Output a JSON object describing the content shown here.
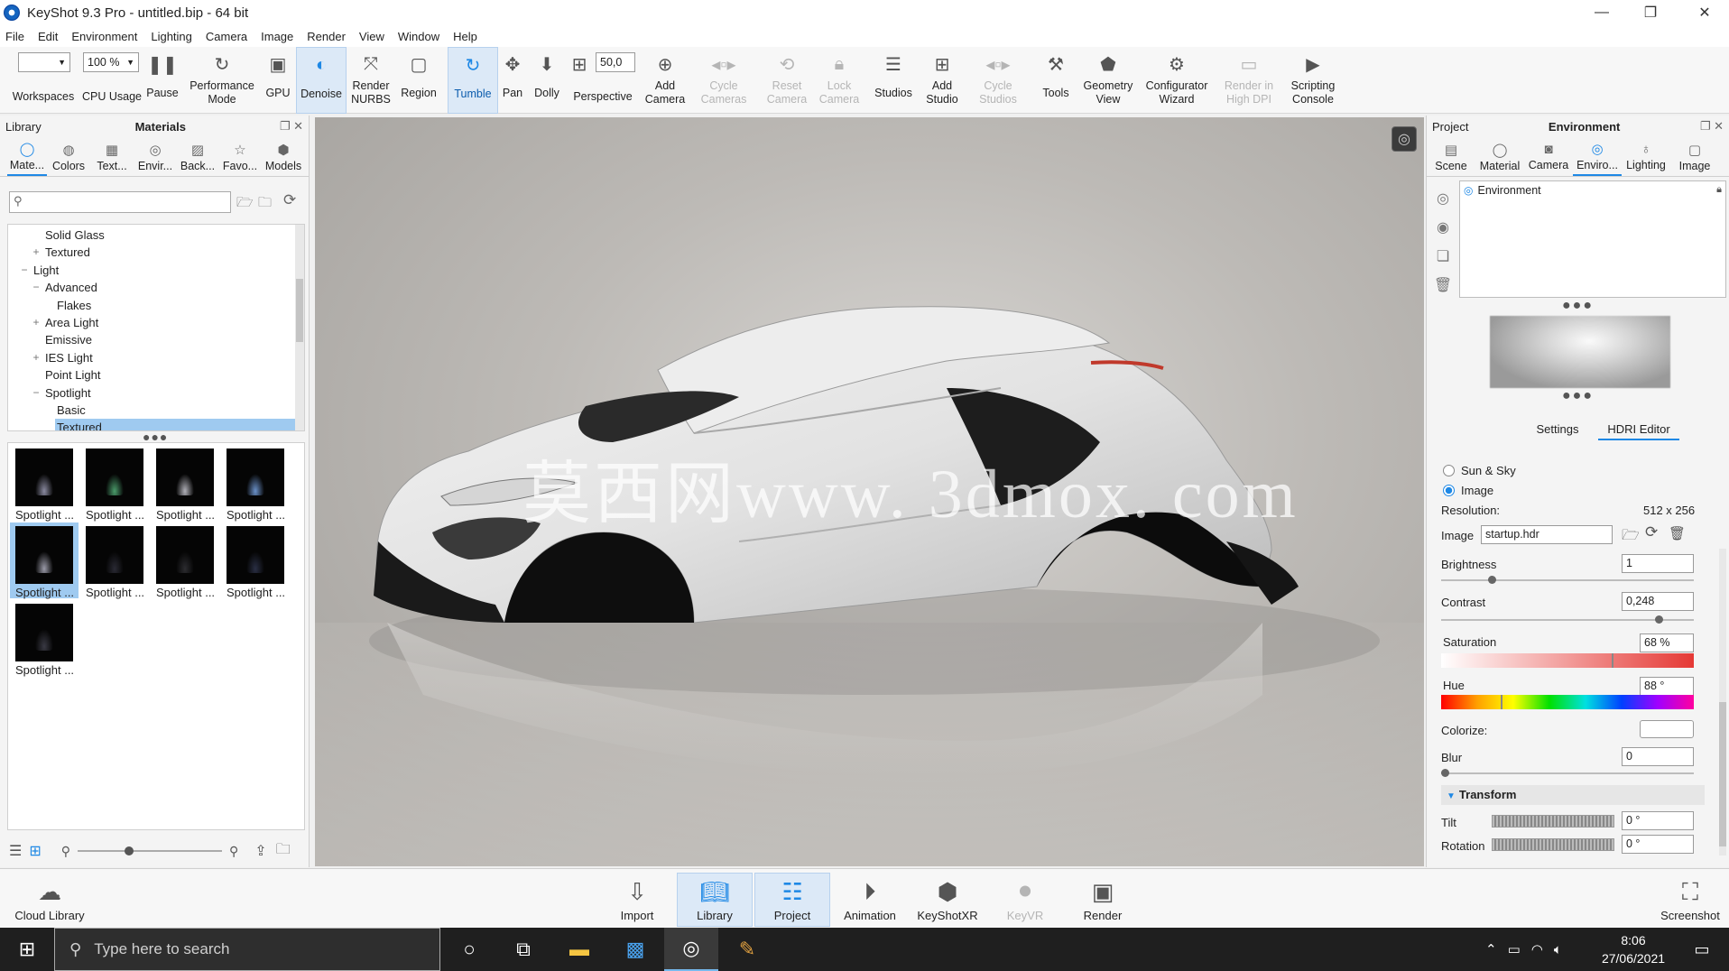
{
  "window": {
    "title": "KeyShot 9.3 Pro  - untitled.bip  - 64 bit",
    "minimize": "—",
    "maximize": "❐",
    "close": "✕"
  },
  "menu": [
    "File",
    "Edit",
    "Environment",
    "Lighting",
    "Camera",
    "Image",
    "Render",
    "View",
    "Window",
    "Help"
  ],
  "toolbar": {
    "workspaces_combo": "",
    "cpu_combo": "100 %",
    "perspective_value": "50,0",
    "items": {
      "workspaces": "Workspaces",
      "cpu_usage": "CPU Usage",
      "pause": "Pause",
      "performance_mode": "Performance\nMode",
      "gpu": "GPU",
      "denoise": "Denoise",
      "render_nurbs": "Render\nNURBS",
      "region": "Region",
      "tumble": "Tumble",
      "pan": "Pan",
      "dolly": "Dolly",
      "perspective": "Perspective",
      "add_camera": "Add\nCamera",
      "cycle_cameras": "Cycle\nCameras",
      "reset_camera": "Reset\nCamera",
      "lock_camera": "Lock\nCamera",
      "studios": "Studios",
      "add_studio": "Add\nStudio",
      "cycle_studios": "Cycle\nStudios",
      "tools": "Tools",
      "geometry_view": "Geometry\nView",
      "configurator_wizard": "Configurator\nWizard",
      "render_high_dpi": "Render in\nHigh DPI",
      "scripting_console": "Scripting\nConsole"
    }
  },
  "library": {
    "header_left": "Library",
    "header_center": "Materials",
    "tabs": [
      "Mate...",
      "Colors",
      "Text...",
      "Envir...",
      "Back...",
      "Favo...",
      "Models"
    ],
    "tree": [
      {
        "label": "Solid Glass",
        "level": 2,
        "exp": ""
      },
      {
        "label": "Textured",
        "level": 2,
        "exp": "+"
      },
      {
        "label": "Light",
        "level": 1,
        "exp": "−"
      },
      {
        "label": "Advanced",
        "level": 2,
        "exp": "−"
      },
      {
        "label": "Flakes",
        "level": 3,
        "exp": ""
      },
      {
        "label": "Area Light",
        "level": 2,
        "exp": "+"
      },
      {
        "label": "Emissive",
        "level": 2,
        "exp": ""
      },
      {
        "label": "IES Light",
        "level": 2,
        "exp": "+"
      },
      {
        "label": "Point Light",
        "level": 2,
        "exp": ""
      },
      {
        "label": "Spotlight",
        "level": 2,
        "exp": "−"
      },
      {
        "label": "Basic",
        "level": 3,
        "exp": ""
      },
      {
        "label": "Textured",
        "level": 3,
        "exp": "",
        "selected": true
      }
    ],
    "thumbnails": [
      {
        "caption": "Spotlight ...",
        "glow": "#8a8aa0"
      },
      {
        "caption": "Spotlight ...",
        "glow": "#4a9a6a"
      },
      {
        "caption": "Spotlight ...",
        "glow": "#b0b0b8"
      },
      {
        "caption": "Spotlight ...",
        "glow": "#6a90c8"
      },
      {
        "caption": "Spotlight ...",
        "glow": "#9a9aa8",
        "selected": true
      },
      {
        "caption": "Spotlight ...",
        "glow": "#2a2a34"
      },
      {
        "caption": "Spotlight ...",
        "glow": "#2c2c30"
      },
      {
        "caption": "Spotlight ...",
        "glow": "#2a2f44"
      },
      {
        "caption": "Spotlight ...",
        "glow": "#3a3a44"
      }
    ]
  },
  "viewport": {
    "watermark": "莫西网www. 3dmox. com"
  },
  "project": {
    "header_left": "Project",
    "header_center": "Environment",
    "tabs": [
      "Scene",
      "Material",
      "Camera",
      "Enviro...",
      "Lighting",
      "Image"
    ],
    "env_list_item": "Environment",
    "subtabs": [
      "Settings",
      "HDRI Editor"
    ],
    "sun_sky_label": "Sun & Sky",
    "image_label": "Image",
    "resolution_label": "Resolution:",
    "resolution_value": "512 x 256",
    "image_field_label": "Image",
    "image_file": "startup.hdr",
    "brightness_label": "Brightness",
    "brightness_value": "1",
    "contrast_label": "Contrast",
    "contrast_value": "0,248",
    "saturation_label": "Saturation",
    "saturation_value": "68 %",
    "hue_label": "Hue",
    "hue_value": "88 °",
    "colorize_label": "Colorize:",
    "blur_label": "Blur",
    "blur_value": "0",
    "transform_label": "Transform",
    "tilt_label": "Tilt",
    "tilt_value": "0 °",
    "rotation_label": "Rotation",
    "rotation_value": "0 °",
    "levels": {
      "brightness": 0.2,
      "contrast": 0.86,
      "saturation": 0.68,
      "hue": 0.24,
      "blur": 0.0
    }
  },
  "bottombar": {
    "cloud_library": "Cloud Library",
    "import": "Import",
    "library": "Library",
    "project": "Project",
    "animation": "Animation",
    "keyshotxr": "KeyShotXR",
    "keyvr": "KeyVR",
    "render": "Render",
    "screenshot": "Screenshot"
  },
  "taskbar": {
    "search_placeholder": "Type here to search",
    "time": "8:06",
    "date": "27/06/2021"
  },
  "colors": {
    "accent": "#1e88e5",
    "selection": "#9fcaf0",
    "taskbar": "#1f1f1f"
  }
}
